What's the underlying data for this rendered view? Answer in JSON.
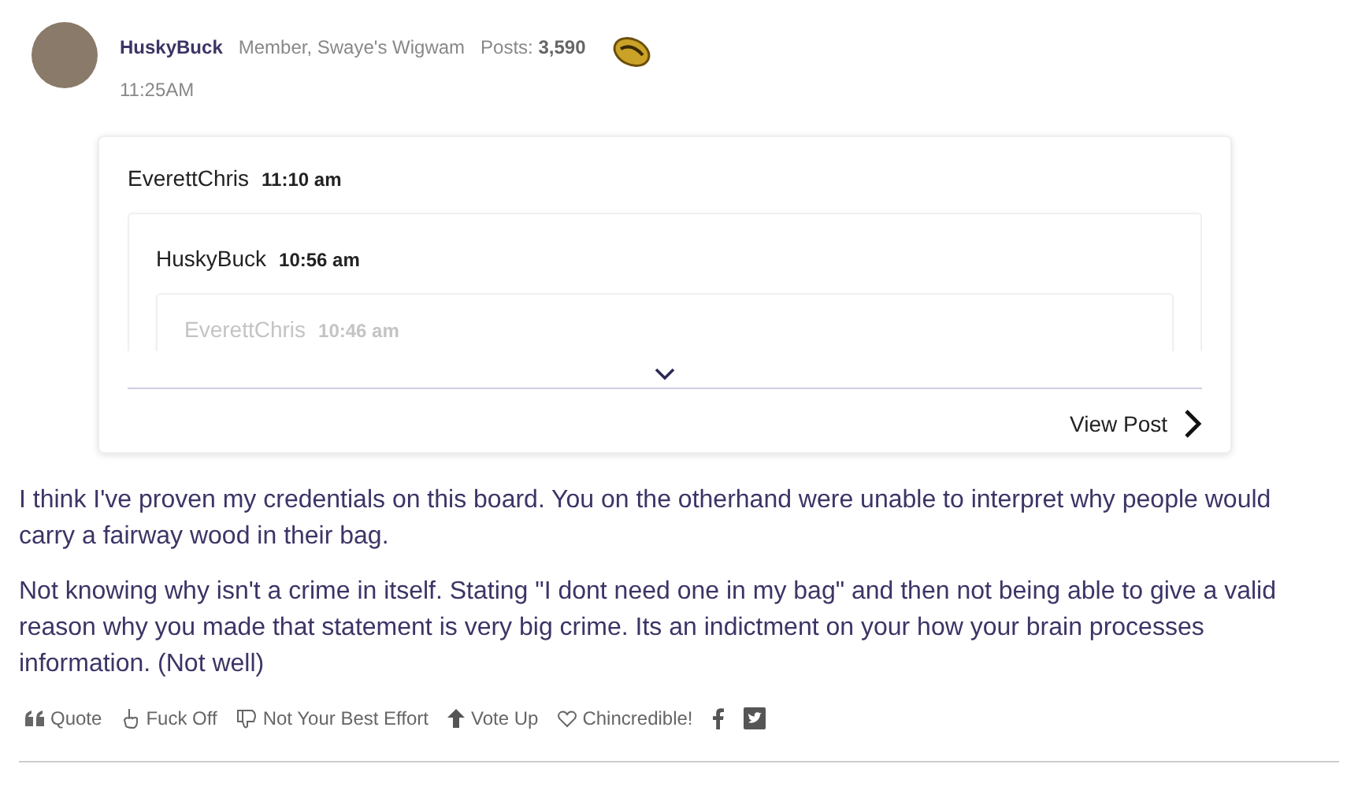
{
  "post": {
    "author": "HuskyBuck",
    "rank": "Member, Swaye's Wigwam",
    "posts_label": "Posts:",
    "posts_count": "3,590",
    "time": "11:25AM"
  },
  "quote": {
    "author": "EverettChris",
    "time": "11:10 am",
    "children": [
      {
        "author": "HuskyBuck",
        "time": "10:56 am",
        "children": [
          {
            "author": "EverettChris",
            "time": "10:46 am"
          }
        ]
      }
    ]
  },
  "view_post": "View Post",
  "body": [
    "I think I've proven my credentials on this board. You on the otherhand were unable to interpret why people would carry a fairway wood in their bag.",
    "Not knowing why isn't a crime in itself. Stating \"I dont need one in my bag\" and then not being able to give a valid reason why you made that statement is very big crime. Its an indictment on your how your brain processes information. (Not well)"
  ],
  "reactions": [
    {
      "kind": "quote",
      "label": "Quote"
    },
    {
      "kind": "finger",
      "label": "Fuck Off"
    },
    {
      "kind": "thumbs-down",
      "label": "Not Your Best Effort"
    },
    {
      "kind": "vote-up",
      "label": "Vote Up"
    },
    {
      "kind": "heart",
      "label": "Chincredible!"
    },
    {
      "kind": "facebook"
    },
    {
      "kind": "twitter"
    }
  ]
}
